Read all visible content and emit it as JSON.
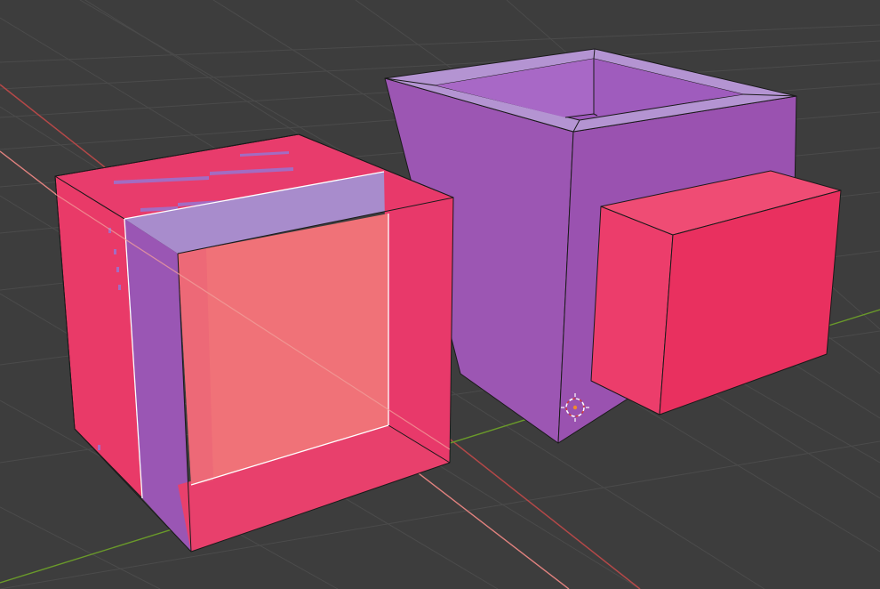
{
  "viewport": {
    "type": "3d-viewport",
    "mode": "edit",
    "background_color": "#3d3d3d",
    "grid_color": "#4a4a4a",
    "x_axis_color": "#c74a4a",
    "y_axis_color": "#6e9e2a"
  },
  "objects": [
    {
      "name": "left-cube",
      "shape": "inset cube with pass-through face",
      "colors": {
        "face_red": "#ea3a6a",
        "face_pink": "#f07078",
        "face_purple": "#9a5ab8",
        "top_lilac": "#a78bcc"
      }
    },
    {
      "name": "open-box",
      "shape": "hollow box open at top",
      "colors": {
        "outer_purple": "#9b55b1",
        "rim_lilac": "#b193d0",
        "inner_purple": "#a15ac0"
      }
    },
    {
      "name": "small-block",
      "shape": "rectangular block",
      "colors": {
        "front_red": "#e93063",
        "top_pink": "#ee4c73"
      }
    }
  ],
  "cursor_3d": {
    "icon": "3d-cursor-icon",
    "color": "#f28a2b"
  }
}
